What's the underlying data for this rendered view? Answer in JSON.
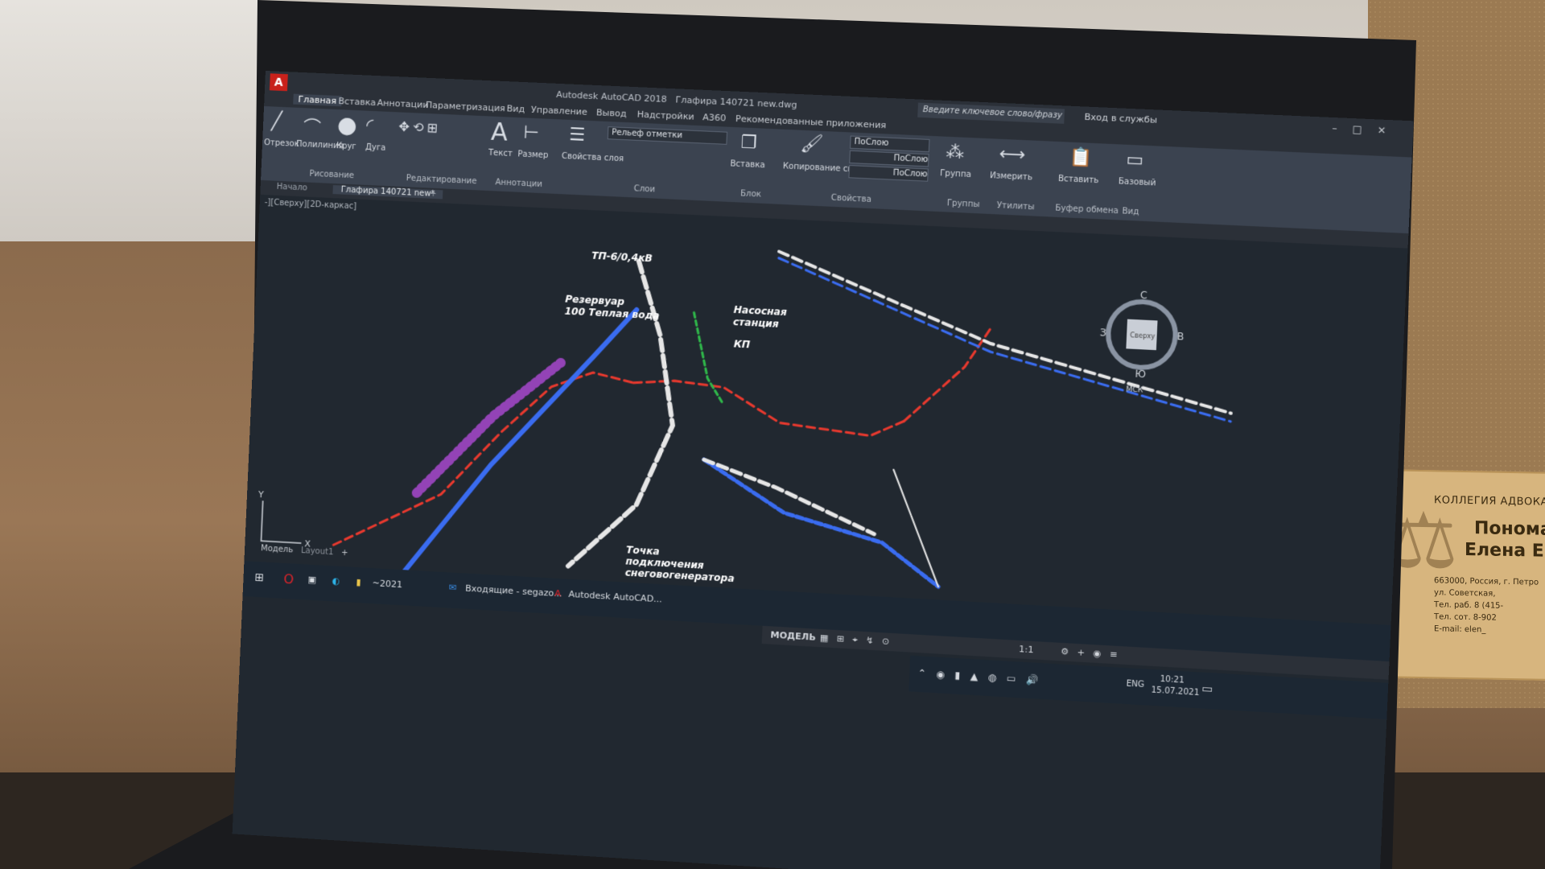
{
  "app": {
    "title": "Autodesk AutoCAD 2018",
    "file": "Глафира 140721 new.dwg",
    "search_placeholder": "Введите ключевое слово/фразу",
    "signin": "Вход в службы"
  },
  "menu": [
    "Главная",
    "Вставка",
    "Аннотации",
    "Параметризация",
    "Вид",
    "Управление",
    "Вывод",
    "Надстройки",
    "A360",
    "Рекомендованные приложения"
  ],
  "ribbon": {
    "draw_tools": [
      "Отрезок",
      "Полилиния",
      "Круг",
      "Дуга"
    ],
    "text": "Текст",
    "size": "Размер",
    "layer_props": "Свойства слоя",
    "layer_dropdown": "Рельеф отметки",
    "insert": "Вставка",
    "copy_props": "Копирование свойств",
    "by_layer_1": "ПоСлою",
    "by_layer_2": "ПоСлою",
    "by_layer_3": "ПоСлою",
    "group": "Группа",
    "measure": "Измерить",
    "paste": "Вставить",
    "base": "Базовый",
    "groups": {
      "draw": "Рисование",
      "edit": "Редактирование",
      "annot": "Аннотации",
      "layers": "Слои",
      "block": "Блок",
      "props": "Свойства",
      "grp": "Группы",
      "util": "Утилиты",
      "clip": "Буфер обмена",
      "view": "Вид"
    }
  },
  "doc_tabs": [
    "Начало",
    "Глафира 140721 new*"
  ],
  "view_label": "-][Сверху][2D-каркас]",
  "drawing_labels": {
    "reservoir": "Резервуар",
    "reservoir2": "100 Теплая вода",
    "tp": "ТП-6/0,4кВ",
    "station": "Насосная",
    "station2": "станция",
    "kp": "КП",
    "point1": "Точка",
    "point2": "подключения",
    "point3": "снеговогенератора"
  },
  "viewcube": {
    "top": "С",
    "left": "З",
    "right": "В",
    "bottom": "Ю",
    "face": "Сверху",
    "mck": "МСК"
  },
  "model_tabs": [
    "Модель",
    "Layout1"
  ],
  "taskbar": {
    "folder": "~2021",
    "outlook": "Входящие - segazo...",
    "autocad": "Autodesk AutoCAD..."
  },
  "status": {
    "model": "МОДЕЛЬ",
    "scale": "1:1"
  },
  "system": {
    "lang": "ENG",
    "time": "10:21",
    "date": "15.07.2021"
  },
  "plaque": {
    "org": "КОЛЛЕГИЯ АДВОКА",
    "name1": "Понома",
    "name2": "Елена Евг",
    "addr1": "663000, Россия, г. Петро",
    "addr2": "ул. Советская,",
    "addr3": "Тел. раб. 8 (415-",
    "addr4": "Тел. сот. 8-902",
    "email": "E-mail: elen_"
  },
  "colors": {
    "red": "#e8392e",
    "blue": "#3a6cf0",
    "white": "#e6e6e6",
    "purple": "#b04ad8",
    "green": "#2fb84a",
    "bg": "#212830"
  }
}
